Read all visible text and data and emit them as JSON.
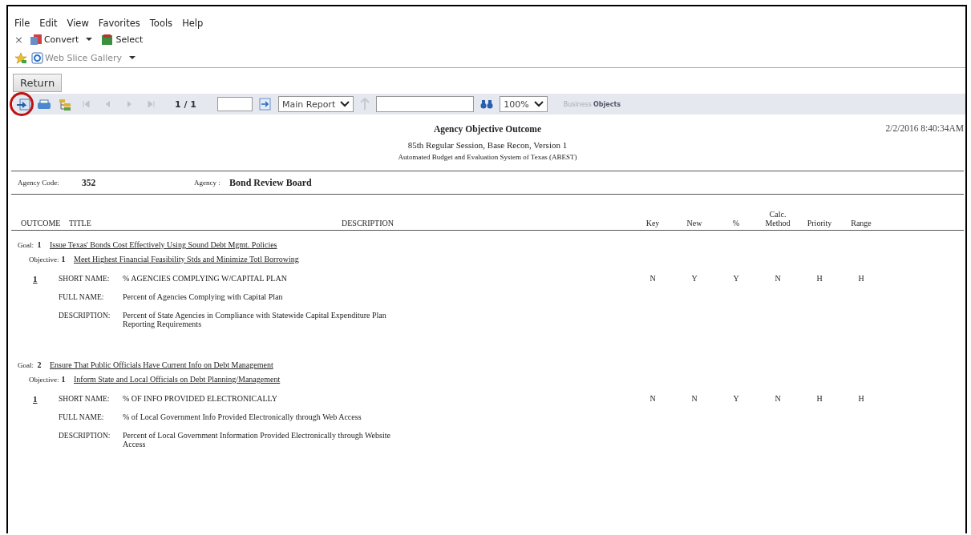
{
  "menu": [
    "File",
    "Edit",
    "View",
    "Favorites",
    "Tools",
    "Help"
  ],
  "command_bar": {
    "close": "×",
    "buttons": [
      {
        "kind": "convert",
        "label": "Convert",
        "dropdown": true
      },
      {
        "kind": "select",
        "label": "Select",
        "dropdown": false
      }
    ]
  },
  "favorites_bar": {
    "items": [
      {
        "kind": "web-slice",
        "label": "Web Slice Gallery",
        "dropdown": true
      }
    ]
  },
  "return_button": "Return",
  "viewer_toolbar": {
    "tools": [
      {
        "kind": "export",
        "circled": true
      },
      {
        "kind": "print",
        "circled": false
      },
      {
        "kind": "group-tree",
        "circled": false
      }
    ],
    "nav": [
      {
        "kind": "first",
        "disabled": true
      },
      {
        "kind": "previous",
        "disabled": true
      },
      {
        "kind": "next",
        "disabled": true
      },
      {
        "kind": "last",
        "disabled": true
      }
    ],
    "page_indicator": "1 / 1",
    "report_select": "Main Report",
    "zoom_select": "100%",
    "logo": [
      "Business",
      "Objects"
    ]
  },
  "report": {
    "title": "Agency Objective Outcome",
    "timestamp": "2/2/2016 8:40:34AM",
    "subtitle": [
      "85th Regular Session, Base Recon, Version 1",
      "Automated Budget and Evaluation System of Texas (ABEST)"
    ],
    "agency_code_label": "Agency Code:",
    "agency_code": "352",
    "agency_label": "Agency :",
    "agency": "Bond Review Board",
    "columns": [
      "OUTCOME",
      "TITLE",
      "DESCRIPTION",
      "Key",
      "New",
      "%",
      "Calc.\nMethod",
      "Priority",
      "Range"
    ],
    "goals": [
      {
        "label": "Goal:",
        "number": "1",
        "title": "Issue Texas' Bonds Cost Effectively Using Sound Debt Mgmt. Policies",
        "objective": {
          "label": "Objective:",
          "number": "1",
          "title": "Meet Highest Financial Feasibility Stds and Minimize Totl Borrowing"
        },
        "measures": [
          {
            "number": "1",
            "fields": [
              {
                "label": "SHORT NAME:",
                "value": "% AGENCIES COMPLYING W/CAPITAL PLAN"
              },
              {
                "label": "FULL NAME:",
                "value": "Percent of Agencies Complying with Capital Plan"
              },
              {
                "label": "DESCRIPTION:",
                "value": "Percent of State Agencies in Compliance with Statewide Capital Expenditure Plan\nReporting Requirements"
              }
            ],
            "flags": [
              "N",
              "Y",
              "Y",
              "N",
              "H",
              "H"
            ]
          }
        ]
      },
      {
        "label": "Goal:",
        "number": "2",
        "title": "Ensure That Public Officials Have Current Info on Debt Management",
        "objective": {
          "label": "Objective:",
          "number": "1",
          "title": "Inform State and Local Officials on Debt Planning/Management"
        },
        "measures": [
          {
            "number": "1",
            "fields": [
              {
                "label": "SHORT NAME:",
                "value": "% OF INFO PROVIDED ELECTRONICALLY"
              },
              {
                "label": "FULL NAME:",
                "value": "% of Local Government Info Provided Electronically through Web Access"
              },
              {
                "label": "DESCRIPTION:",
                "value": "Percent of Local Government Information Provided Electronically through Website\nAccess"
              }
            ],
            "flags": [
              "N",
              "N",
              "Y",
              "N",
              "H",
              "H"
            ]
          }
        ]
      }
    ]
  }
}
